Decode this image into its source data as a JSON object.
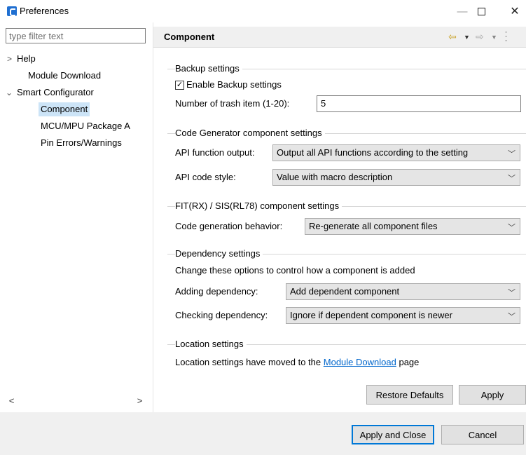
{
  "window": {
    "title": "Preferences",
    "min_glyph": "—",
    "close_glyph": "✕"
  },
  "filter": {
    "placeholder": "type filter text"
  },
  "tree": {
    "help": "Help",
    "module_download": "Module Download",
    "smart_configurator": "Smart Configurator",
    "component": "Component",
    "mcu_package": "MCU/MPU Package A",
    "pin_errors": "Pin Errors/Warnings"
  },
  "page": {
    "title": "Component"
  },
  "backup": {
    "title": "Backup settings",
    "enable_label": "Enable Backup settings",
    "enabled": true,
    "trash_label": "Number of trash item (1-20):",
    "trash_value": "5"
  },
  "codegen": {
    "title": "Code Generator component settings",
    "api_output_label": "API function output:",
    "api_output_value": "Output all API functions according to the setting",
    "api_style_label": "API code style:",
    "api_style_value": "Value with macro description"
  },
  "fit": {
    "title": "FIT(RX) / SIS(RL78) component settings",
    "behavior_label": "Code generation behavior:",
    "behavior_value": "Re-generate all component files"
  },
  "dependency": {
    "title": "Dependency settings",
    "description": "Change these options to control how a component is added",
    "adding_label": "Adding dependency:",
    "adding_value": "Add dependent component",
    "checking_label": "Checking dependency:",
    "checking_value": "Ignore if dependent component is newer"
  },
  "location": {
    "title": "Location settings",
    "text_before": "Location settings have moved to the",
    "link_text": "Module Download",
    "text_after": "page"
  },
  "buttons": {
    "restore_defaults": "Restore Defaults",
    "apply": "Apply",
    "apply_and_close": "Apply and Close",
    "cancel": "Cancel"
  }
}
